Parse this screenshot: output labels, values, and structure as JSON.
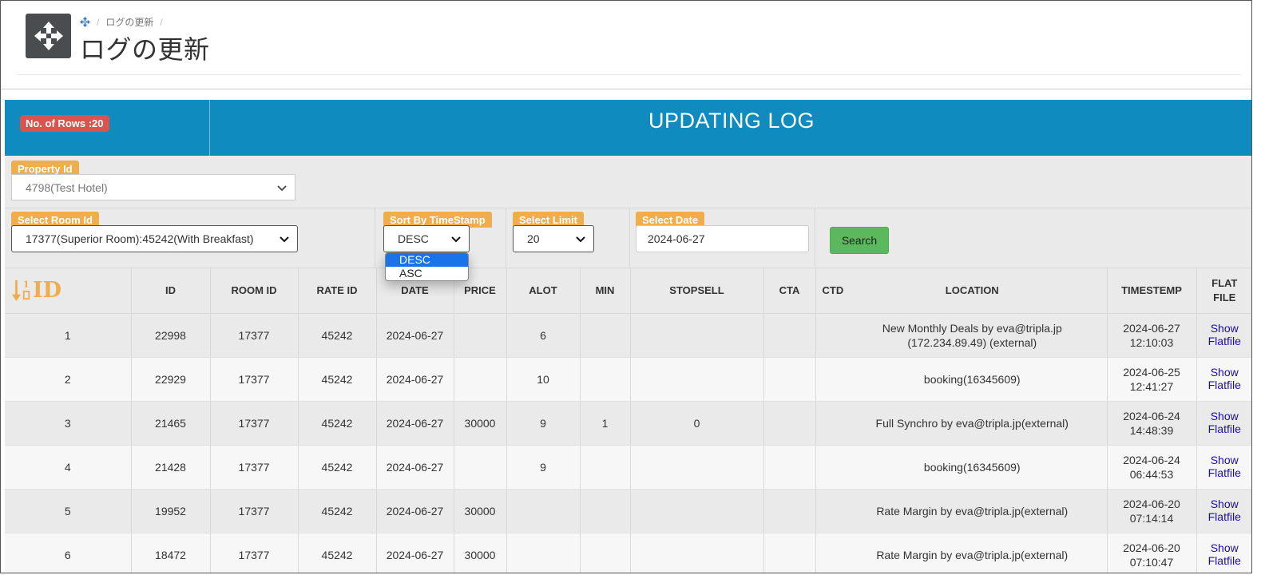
{
  "header": {
    "breadcrumb_current": "ログの更新",
    "title": "ログの更新"
  },
  "banner": {
    "rows_badge": "No. of Rows :20",
    "title": "UPDATING LOG"
  },
  "filters": {
    "property_label": "Property Id",
    "property_value": "4798(Test Hotel)",
    "room_label": "Select Room Id",
    "room_value": "17377(Superior Room):45242(With Breakfast)",
    "sort_label": "Sort By TimeStamp",
    "sort_value": "DESC",
    "sort_options": [
      "DESC",
      "ASC"
    ],
    "limit_label": "Select Limit",
    "limit_value": "20",
    "date_label": "Select Date",
    "date_value": "2024-06-27",
    "search_label": "Search"
  },
  "table": {
    "sort_icon_label": "ID",
    "headers": [
      "ID",
      "ROOM ID",
      "RATE ID",
      "DATE",
      "PRICE",
      "ALOT",
      "MIN",
      "STOPSELL",
      "CTA",
      "CTD",
      "LOCATION",
      "TIMESTEMP",
      "FLAT FILE"
    ],
    "link_label_1": "Show",
    "link_label_2": "Flatfile",
    "rows": [
      {
        "n": "1",
        "id": "22998",
        "room": "17377",
        "rate": "45242",
        "date": "2024-06-27",
        "price": "",
        "alot": "6",
        "min": "",
        "stopsell": "",
        "cta": "",
        "ctd": "",
        "location": "New Monthly Deals by eva@tripla.jp (172.234.89.49) (external)",
        "ts_date": "2024-06-27",
        "ts_time": "12:10:03"
      },
      {
        "n": "2",
        "id": "22929",
        "room": "17377",
        "rate": "45242",
        "date": "2024-06-27",
        "price": "",
        "alot": "10",
        "min": "",
        "stopsell": "",
        "cta": "",
        "ctd": "",
        "location": "booking(16345609)",
        "ts_date": "2024-06-25",
        "ts_time": "12:41:27"
      },
      {
        "n": "3",
        "id": "21465",
        "room": "17377",
        "rate": "45242",
        "date": "2024-06-27",
        "price": "30000",
        "alot": "9",
        "min": "1",
        "stopsell": "0",
        "cta": "",
        "ctd": "",
        "location": "Full Synchro by eva@tripla.jp(external)",
        "ts_date": "2024-06-24",
        "ts_time": "14:48:39"
      },
      {
        "n": "4",
        "id": "21428",
        "room": "17377",
        "rate": "45242",
        "date": "2024-06-27",
        "price": "",
        "alot": "9",
        "min": "",
        "stopsell": "",
        "cta": "",
        "ctd": "",
        "location": "booking(16345609)",
        "ts_date": "2024-06-24",
        "ts_time": "06:44:53"
      },
      {
        "n": "5",
        "id": "19952",
        "room": "17377",
        "rate": "45242",
        "date": "2024-06-27",
        "price": "30000",
        "alot": "",
        "min": "",
        "stopsell": "",
        "cta": "",
        "ctd": "",
        "location": "Rate Margin by eva@tripla.jp(external)",
        "ts_date": "2024-06-20",
        "ts_time": "07:14:14"
      },
      {
        "n": "6",
        "id": "18472",
        "room": "17377",
        "rate": "45242",
        "date": "2024-06-27",
        "price": "30000",
        "alot": "",
        "min": "",
        "stopsell": "",
        "cta": "",
        "ctd": "",
        "location": "Rate Margin by eva@tripla.jp(external)",
        "ts_date": "2024-06-20",
        "ts_time": "07:10:47"
      }
    ]
  },
  "colors": {
    "banner": "#0f8bc0",
    "badge": "#d9534f",
    "label": "#f0ad4e",
    "search": "#5cb85c",
    "dropdown_highlight": "#1a73e8",
    "link": "#1a0dab"
  }
}
